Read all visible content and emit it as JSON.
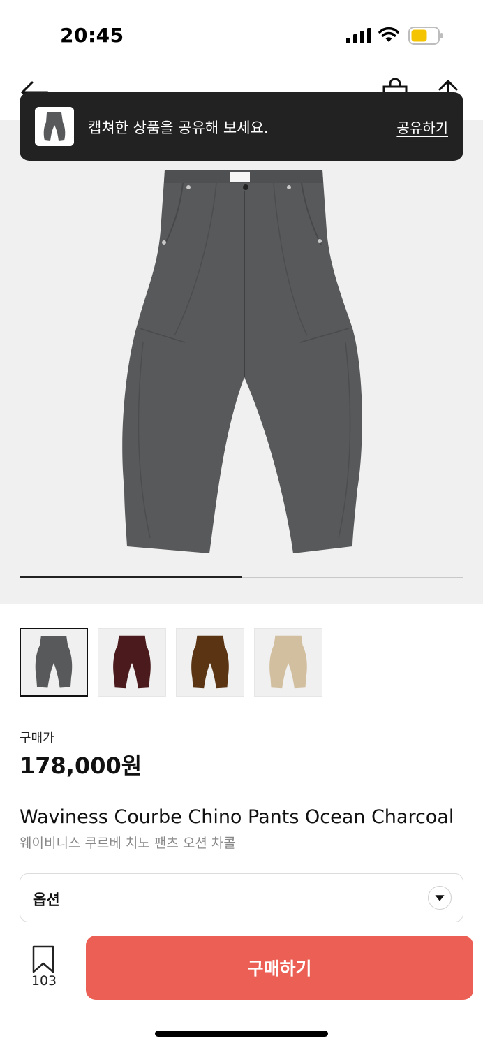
{
  "status_bar": {
    "time": "20:45",
    "icons": [
      "signal-icon",
      "wifi-icon",
      "battery-icon"
    ],
    "battery_color": "#f5c400"
  },
  "header": {
    "icons": [
      "back-arrow-icon",
      "shopping-bag-icon",
      "share-icon"
    ]
  },
  "toast": {
    "message": "캡쳐한 상품을 공유해 보세요.",
    "action_label": "공유하기"
  },
  "gallery": {
    "progress": 0.5,
    "product_color": "#58595a"
  },
  "color_options": [
    {
      "name": "charcoal",
      "color": "#58595a",
      "selected": true
    },
    {
      "name": "burgundy",
      "color": "#4a1a1c",
      "selected": false
    },
    {
      "name": "brown",
      "color": "#5b3414",
      "selected": false
    },
    {
      "name": "beige",
      "color": "#d2bf9f",
      "selected": false
    }
  ],
  "price": {
    "label": "구매가",
    "value": "178,000원"
  },
  "product": {
    "name_en": "Waviness Courbe Chino Pants Ocean Charcoal",
    "name_ko": "웨이비니스 쿠르베 치노 팬츠 오션 차콜"
  },
  "option": {
    "label": "옵션"
  },
  "bottom_bar": {
    "bookmark_count": "103",
    "buy_label": "구매하기",
    "buy_color": "#ec5f55"
  }
}
